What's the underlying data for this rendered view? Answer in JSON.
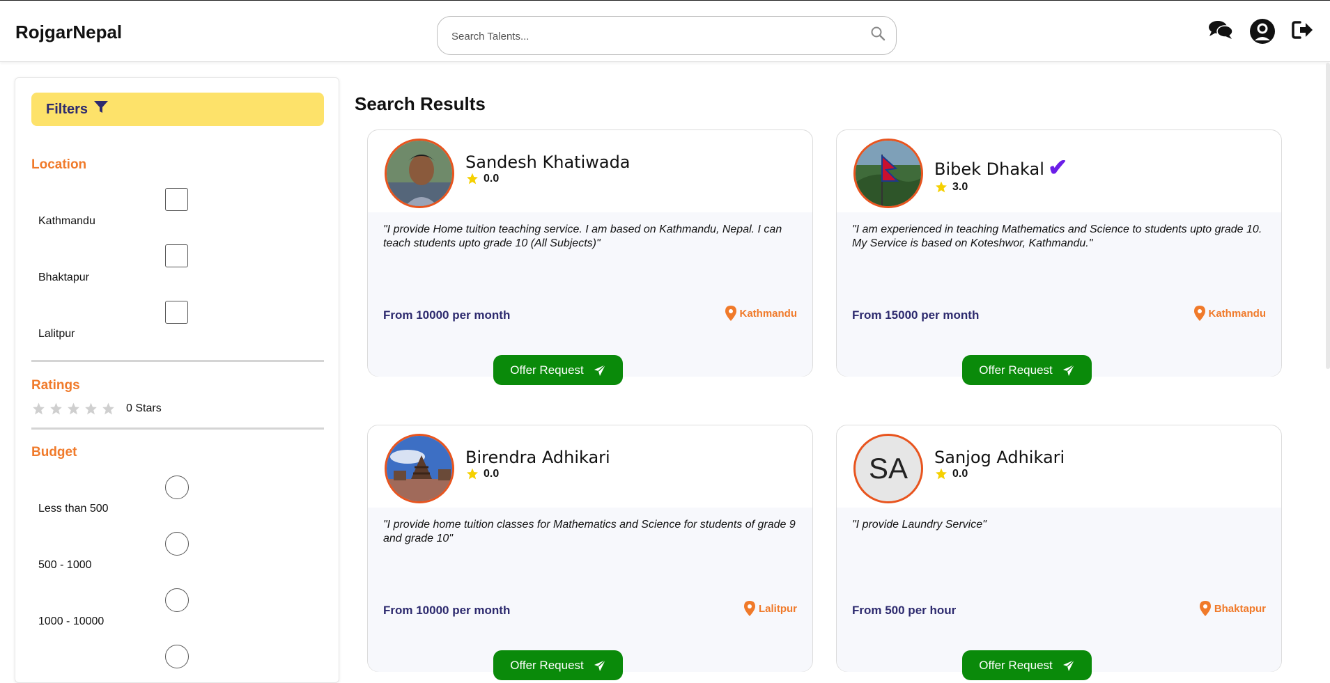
{
  "app": {
    "brand": "RojgarNepal"
  },
  "search": {
    "placeholder": "Search Talents..."
  },
  "header_icons": [
    "chat-icon",
    "user-avatar-icon",
    "logout-icon"
  ],
  "sidebar": {
    "filters_label": "Filters",
    "location": {
      "title": "Location",
      "options": [
        "Kathmandu",
        "Bhaktapur",
        "Lalitpur"
      ]
    },
    "ratings": {
      "title": "Ratings",
      "stars_label": "0 Stars",
      "value": 0
    },
    "budget": {
      "title": "Budget",
      "options": [
        "Less than 500",
        "500 - 1000",
        "1000 - 10000"
      ]
    }
  },
  "results": {
    "title": "Search Results",
    "offer_label": "Offer Request",
    "cards": [
      {
        "name": "Sandesh Khatiwada",
        "rating": "0.0",
        "verified": false,
        "description": "\"I provide Home tuition teaching service. I am based on Kathmandu, Nepal. I can teach students upto grade 10 (All Subjects)\"",
        "price": "From 10000 per month",
        "location": "Kathmandu"
      },
      {
        "name": "Bibek Dhakal",
        "rating": "3.0",
        "verified": true,
        "description": "\"I am experienced in teaching Mathematics and Science to students upto grade 10. My Service is based on Koteshwor, Kathmandu.\"",
        "price": "From 15000 per month",
        "location": "Kathmandu"
      },
      {
        "name": "Birendra Adhikari",
        "rating": "0.0",
        "verified": false,
        "description": "\"I provide home tuition classes for Mathematics and Science for students of grade 9 and grade 10\"",
        "price": "From 10000 per month",
        "location": "Lalitpur"
      },
      {
        "name": "Sanjog Adhikari",
        "initials": "SA",
        "rating": "0.0",
        "verified": false,
        "description": "\"I provide Laundry Service\"",
        "price": "From 500 per hour",
        "location": "Bhaktapur"
      }
    ]
  },
  "colors": {
    "accent_orange": "#f07a2a",
    "filter_yellow": "#fde26a",
    "button_green": "#0a8a0a",
    "navy": "#2d2a6e",
    "verified_purple": "#6b1ee8"
  }
}
